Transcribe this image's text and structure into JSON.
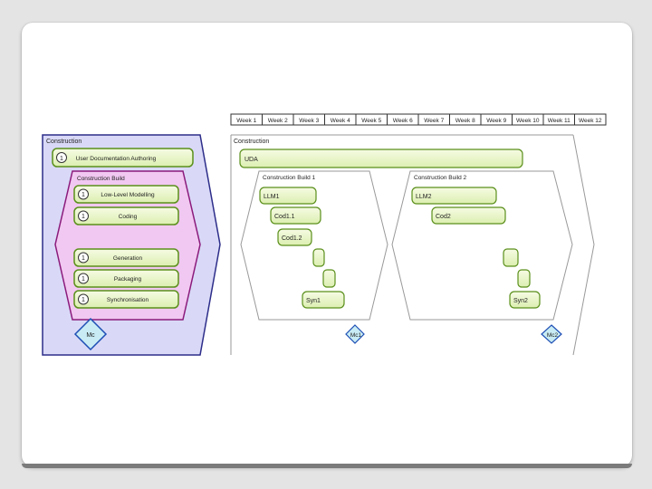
{
  "left_panel": {
    "title": "Construction",
    "top_activity": {
      "badge": "1",
      "label": "User Documentation Authoring"
    },
    "build_title": "Construction Build",
    "build_activities": [
      {
        "badge": "1",
        "label": "Low-Level Modelling"
      },
      {
        "badge": "1",
        "label": "Coding"
      }
    ],
    "lower_activities": [
      {
        "badge": "1",
        "label": "Generation"
      },
      {
        "badge": "1",
        "label": "Packaging"
      },
      {
        "badge": "1",
        "label": "Synchronisation"
      }
    ],
    "milestone": "Mc"
  },
  "gantt": {
    "weeks": [
      "Week 1",
      "Week 2",
      "Week 3",
      "Week 4",
      "Week 5",
      "Week 6",
      "Week 7",
      "Week 8",
      "Week 9",
      "Week 10",
      "Week 11",
      "Week 12"
    ],
    "phase_title": "Construction",
    "phase_bar_label": "UDA",
    "build1": {
      "title": "Construction Build 1",
      "bars": [
        "LLM1",
        "Cod1.1",
        "Cod1.2",
        "",
        "",
        "Syn1"
      ],
      "milestone": "Mc1"
    },
    "build2": {
      "title": "Construction Build 2",
      "bars": [
        "LLM2",
        "Cod2",
        "",
        "",
        "Syn2"
      ],
      "milestone": "Mc2"
    }
  },
  "colors": {
    "activity_fill": "#ecf7c7",
    "activity_border": "#5a8f1b",
    "phase_fill": "#d9d9f7",
    "phase_border": "#2d2d8a",
    "build_fill": "#f1c8f1",
    "build_border": "#8b1b7c",
    "milestone_fill": "#c9ecf4",
    "milestone_border": "#1e4fb5"
  }
}
